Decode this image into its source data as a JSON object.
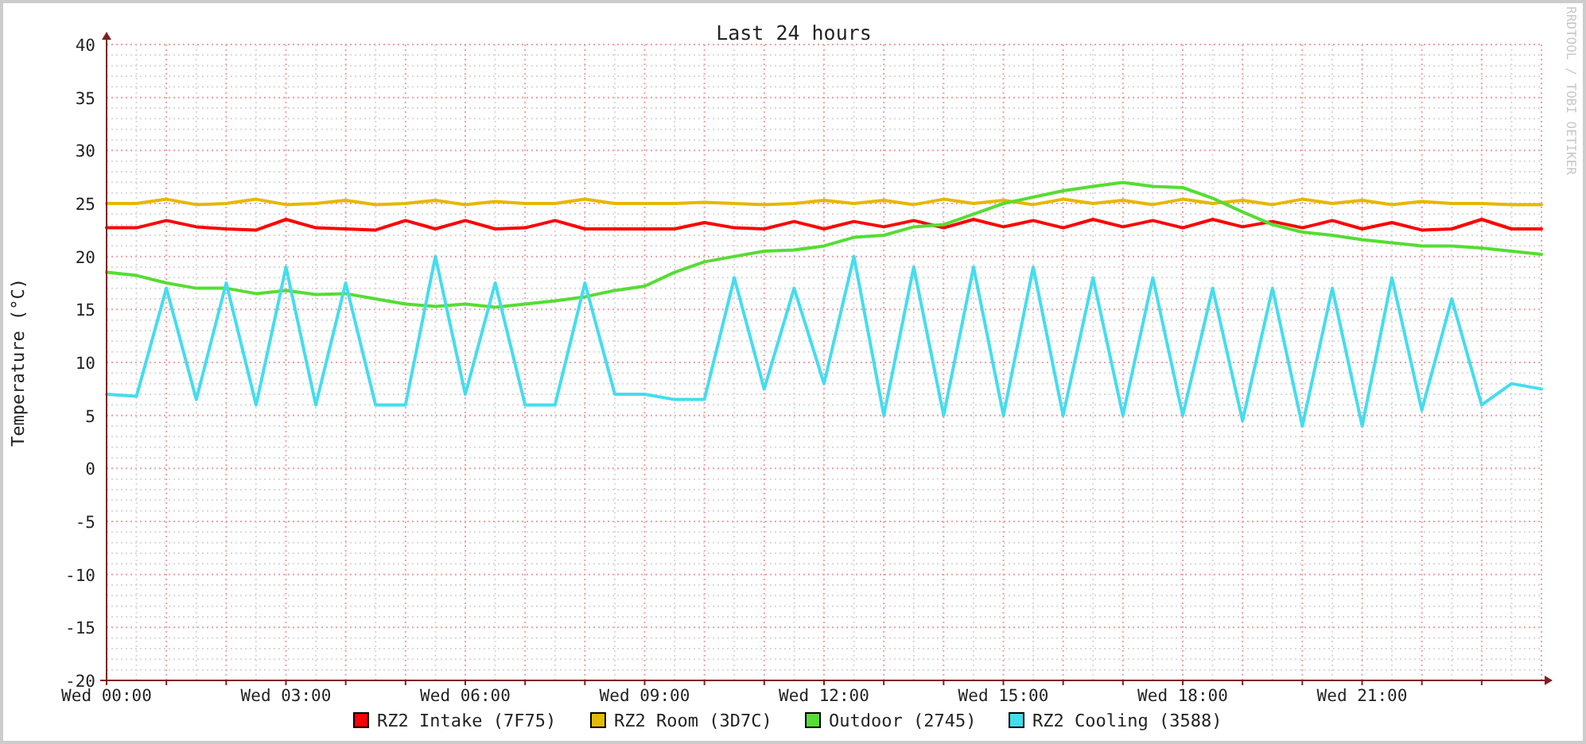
{
  "chart": {
    "chart_data": {
      "type": "line",
      "title": "Last 24 hours",
      "ylabel": "Temperature (°C)",
      "categories": [
        "Wed 00:00",
        null,
        null,
        null,
        null,
        null,
        "Wed 03:00",
        null,
        null,
        null,
        null,
        null,
        "Wed 06:00",
        null,
        null,
        null,
        null,
        null,
        "Wed 09:00",
        null,
        null,
        null,
        null,
        null,
        "Wed 12:00",
        null,
        null,
        null,
        null,
        null,
        "Wed 15:00",
        null,
        null,
        null,
        null,
        null,
        "Wed 18:00",
        null,
        null,
        null,
        null,
        null,
        "Wed 21:00",
        null,
        null,
        null,
        null,
        null,
        null
      ],
      "ylim": [
        -20,
        40
      ],
      "grid": true,
      "legend": "bottom",
      "yticks": [
        40,
        35,
        30,
        25,
        20,
        15,
        10,
        5,
        0,
        -5,
        -10,
        -15,
        -20
      ],
      "series": [
        {
          "name": "RZ2 Intake (7F75)",
          "color": "#ff0000",
          "values": [
            22.7,
            22.7,
            23.4,
            22.8,
            22.6,
            22.5,
            23.5,
            22.7,
            22.6,
            22.5,
            23.4,
            22.6,
            23.4,
            22.6,
            22.7,
            23.4,
            22.6,
            22.6,
            22.6,
            22.6,
            23.2,
            22.7,
            22.6,
            23.3,
            22.6,
            23.3,
            22.8,
            23.4,
            22.7,
            23.5,
            22.8,
            23.4,
            22.7,
            23.5,
            22.8,
            23.4,
            22.7,
            23.5,
            22.8,
            23.3,
            22.7,
            23.4,
            22.6,
            23.2,
            22.5,
            22.6,
            23.5,
            22.6,
            22.6
          ]
        },
        {
          "name": "RZ2 Room (3D7C)",
          "color": "#e6b800",
          "values": [
            25.0,
            25.0,
            25.4,
            24.9,
            25.0,
            25.4,
            24.9,
            25.0,
            25.3,
            24.9,
            25.0,
            25.3,
            24.9,
            25.2,
            25.0,
            25.0,
            25.4,
            25.0,
            25.0,
            25.0,
            25.1,
            25.0,
            24.9,
            25.0,
            25.3,
            25.0,
            25.3,
            24.9,
            25.4,
            25.0,
            25.3,
            24.9,
            25.4,
            25.0,
            25.3,
            24.9,
            25.4,
            25.0,
            25.3,
            24.9,
            25.4,
            25.0,
            25.3,
            24.9,
            25.2,
            25.0,
            25.0,
            24.9,
            24.9
          ]
        },
        {
          "name": "Outdoor (2745)",
          "color": "#55dd33",
          "values": [
            18.5,
            18.2,
            17.5,
            17.0,
            17.0,
            16.5,
            16.8,
            16.4,
            16.5,
            16.0,
            15.5,
            15.3,
            15.5,
            15.2,
            15.5,
            15.8,
            16.2,
            16.8,
            17.2,
            18.5,
            19.5,
            20.0,
            20.5,
            20.6,
            21.0,
            21.8,
            22.0,
            22.8,
            23.0,
            24.0,
            25.0,
            25.6,
            26.2,
            26.6,
            27.0,
            26.6,
            26.5,
            25.5,
            24.2,
            23.0,
            22.3,
            22.0,
            21.6,
            21.3,
            21.0,
            21.0,
            20.8,
            20.5,
            20.2
          ]
        },
        {
          "name": "RZ2 Cooling (3588)",
          "color": "#44ddee",
          "values": [
            7.0,
            6.8,
            17.0,
            6.5,
            17.5,
            6.0,
            19.0,
            6.0,
            17.5,
            6.0,
            6.0,
            20.0,
            7.0,
            17.5,
            6.0,
            6.0,
            17.5,
            7.0,
            7.0,
            6.5,
            6.5,
            18.0,
            7.5,
            17.0,
            8.0,
            20.0,
            5.0,
            19.0,
            5.0,
            19.0,
            5.0,
            19.0,
            5.0,
            18.0,
            5.0,
            18.0,
            5.0,
            17.0,
            4.5,
            17.0,
            4.0,
            17.0,
            4.0,
            18.0,
            5.5,
            16.0,
            6.0,
            8.0,
            7.5
          ]
        }
      ]
    },
    "credit": "RRDTOOL / TOBI OETIKER"
  }
}
